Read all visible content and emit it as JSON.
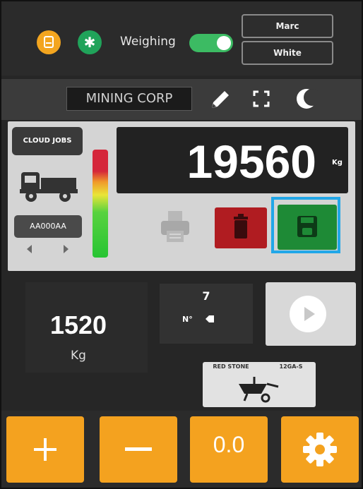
{
  "status": {
    "printer_icon": "printer-icon",
    "bluetooth_icon": "bluetooth-icon",
    "weighing_label": "Weighing",
    "weighing_enabled": true
  },
  "operator": {
    "name": "Marc",
    "shift": "White"
  },
  "header": {
    "company": "MINING CORP"
  },
  "scale": {
    "cloud_jobs_label": "CLOUD JOBS",
    "vehicle_plate": "AA000AA",
    "weight": "19560",
    "unit": "Kg"
  },
  "lower": {
    "tare_weight": "1520",
    "tare_unit": "Kg",
    "count_value": "7",
    "count_label": "N°",
    "material_name": "RED STONE",
    "material_code": "12GA-S"
  },
  "bottom": {
    "zero_label": "0.0"
  },
  "colors": {
    "accent_orange": "#f4a21f",
    "save_green": "#1e8a36",
    "delete_red": "#b01c21",
    "highlight_blue": "#21a7e8",
    "bluetooth_green": "#20a35a"
  }
}
